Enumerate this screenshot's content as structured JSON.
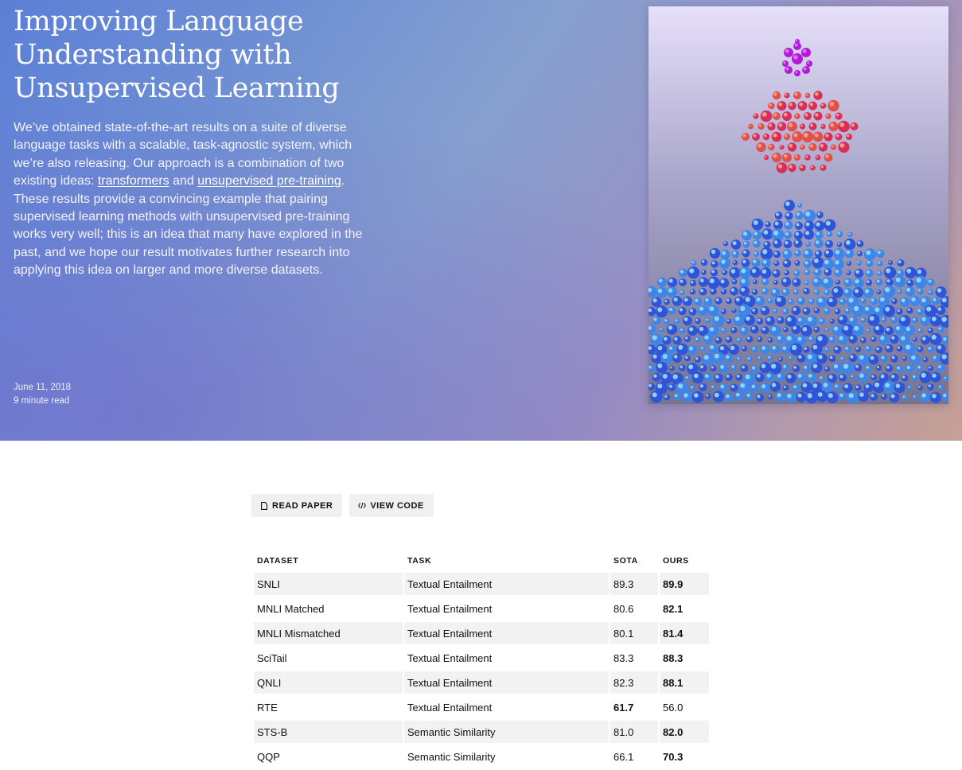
{
  "hero": {
    "title": "Improving Language Understanding with Unsupervised Learning",
    "intro": {
      "part1": "We’ve obtained state-of-the-art results on a suite of diverse language tasks with a scalable, task-agnostic system, which we’re also releasing. Our approach is a combination of two existing ideas: ",
      "link1": "transformers",
      "part2": " and ",
      "link2": "unsupervised pre-training",
      "part3": ". These results provide a convincing example that pairing supervised learning methods with unsupervised pre-training works very well; this is an idea that many have explored in the past, and we hope our result motivates further research into applying this idea on larger and more diverse datasets."
    },
    "date": "June 11, 2018",
    "read_time": "9 minute read"
  },
  "actions": {
    "read_paper": "READ PAPER",
    "view_code": "VIEW CODE"
  },
  "table": {
    "headers": [
      "DATASET",
      "TASK",
      "SOTA",
      "OURS"
    ],
    "rows": [
      {
        "dataset": "SNLI",
        "task": "Textual Entailment",
        "sota": "89.3",
        "ours": "89.9",
        "best": "ours"
      },
      {
        "dataset": "MNLI Matched",
        "task": "Textual Entailment",
        "sota": "80.6",
        "ours": "82.1",
        "best": "ours"
      },
      {
        "dataset": "MNLI Mismatched",
        "task": "Textual Entailment",
        "sota": "80.1",
        "ours": "81.4",
        "best": "ours"
      },
      {
        "dataset": "SciTail",
        "task": "Textual Entailment",
        "sota": "83.3",
        "ours": "88.3",
        "best": "ours"
      },
      {
        "dataset": "QNLI",
        "task": "Textual Entailment",
        "sota": "82.3",
        "ours": "88.1",
        "best": "ours"
      },
      {
        "dataset": "RTE",
        "task": "Textual Entailment",
        "sota": "61.7",
        "ours": "56.0",
        "best": "sota"
      },
      {
        "dataset": "STS-B",
        "task": "Semantic Similarity",
        "sota": "81.0",
        "ours": "82.0",
        "best": "ours"
      },
      {
        "dataset": "QQP",
        "task": "Semantic Similarity",
        "sota": "66.1",
        "ours": "70.3",
        "best": "ours"
      }
    ]
  },
  "colors": {
    "hero_blue": "#5c7fd6",
    "hero_peach": "#c8a094",
    "row_alt": "#f2f2f2",
    "button_bg": "#f0f0f0"
  }
}
